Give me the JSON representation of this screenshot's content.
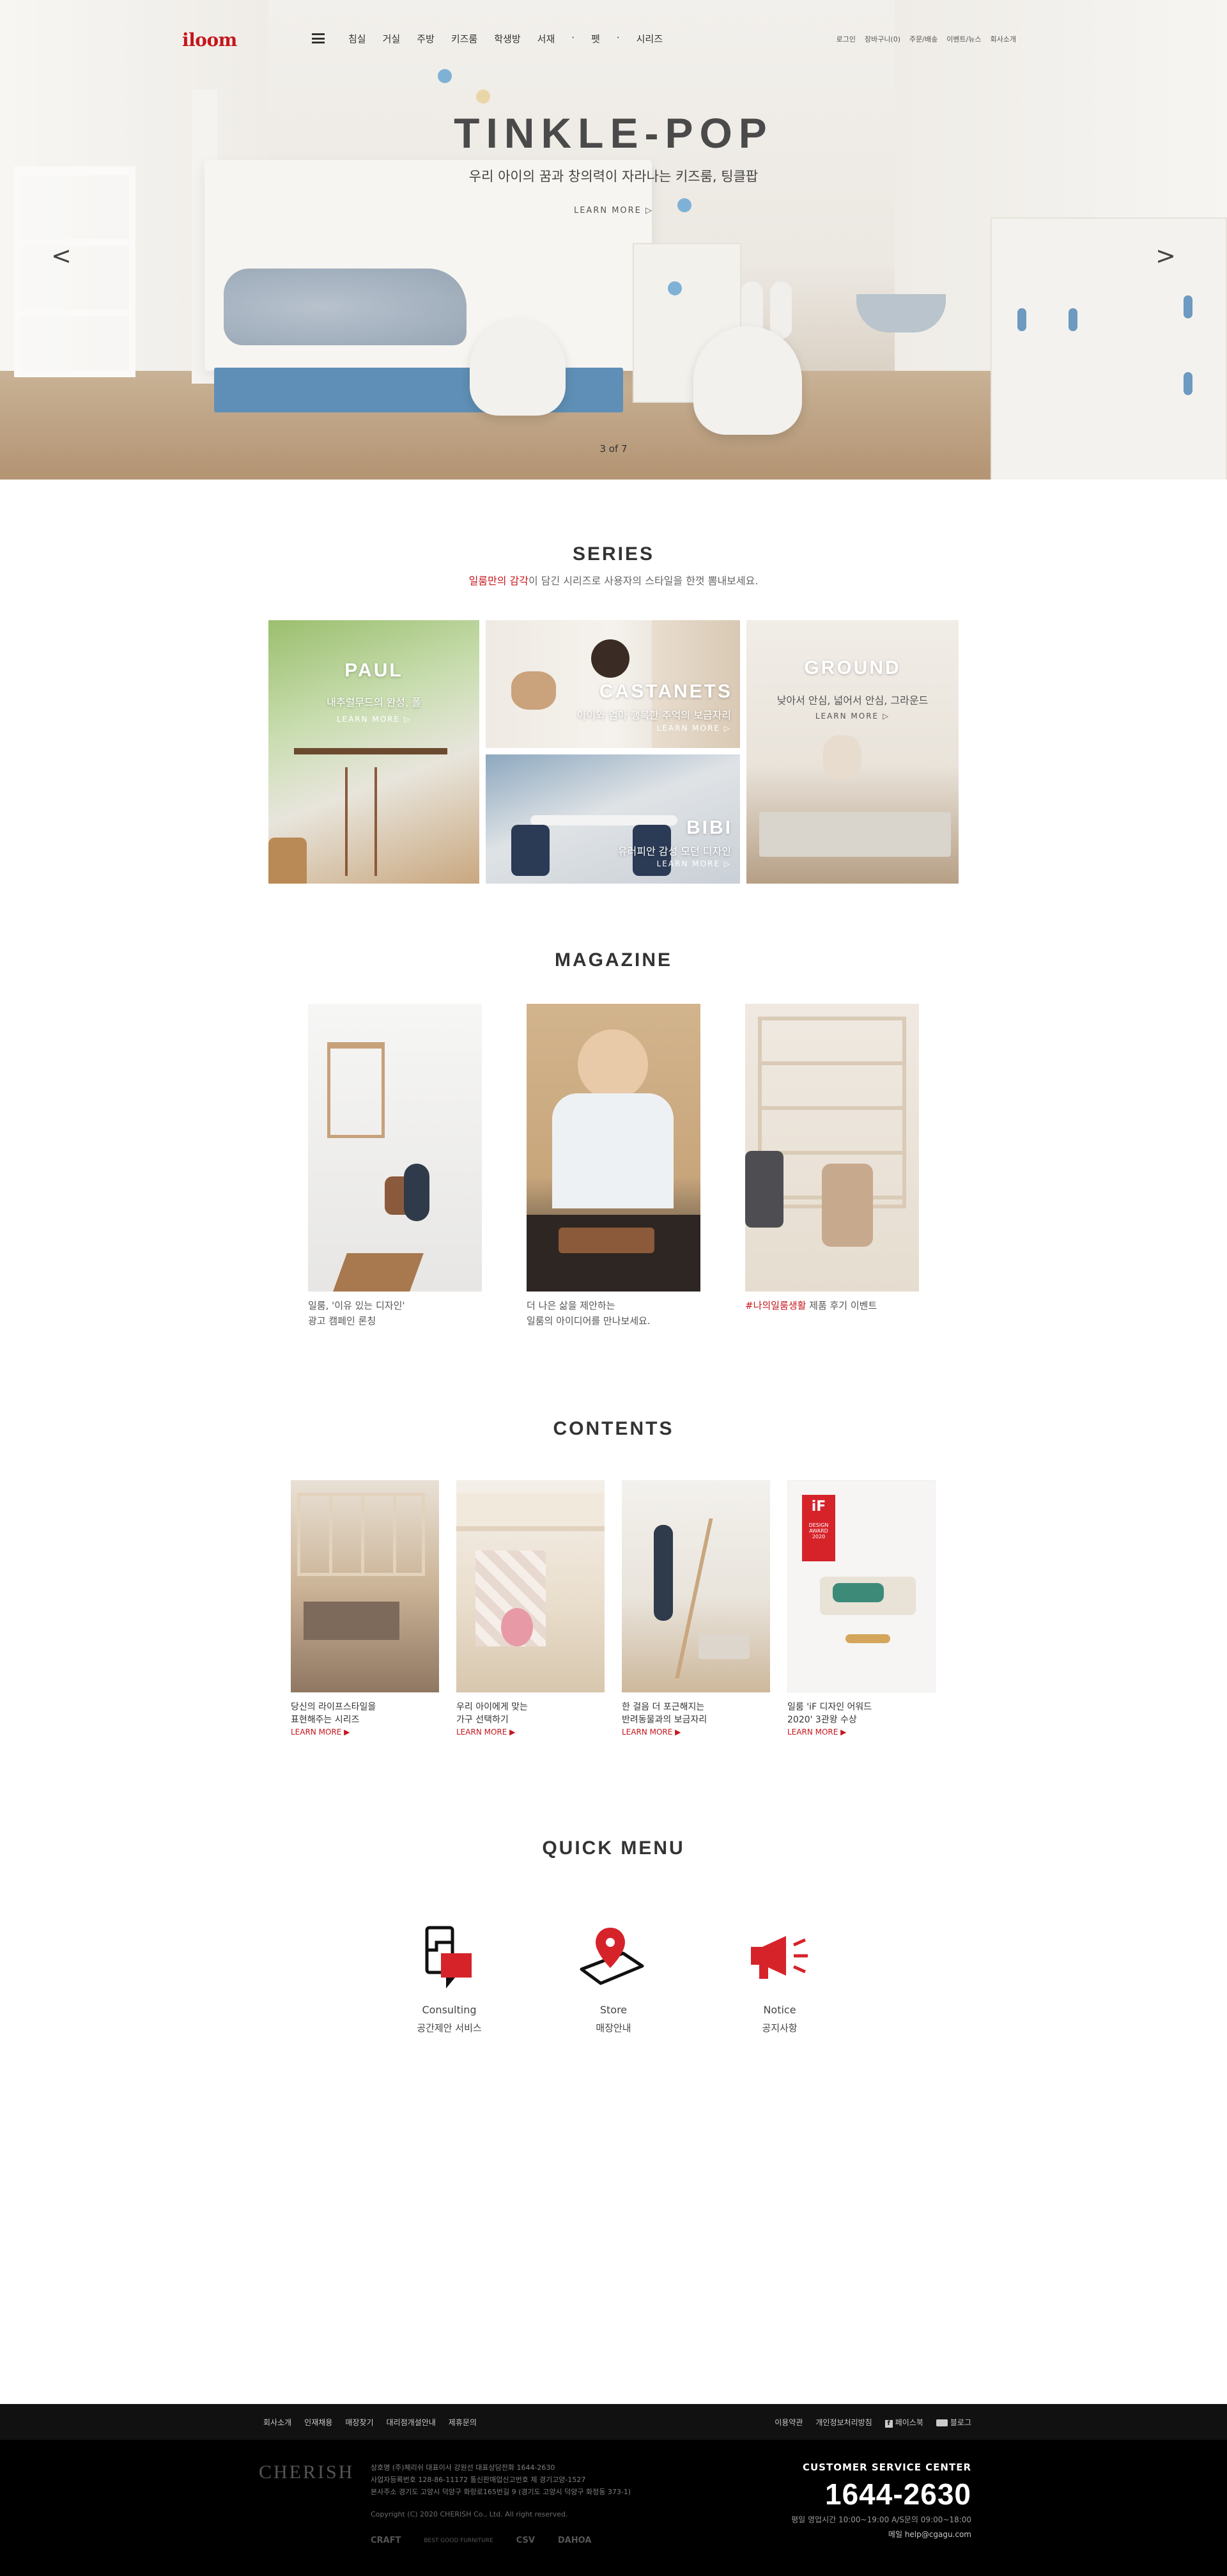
{
  "header": {
    "logo": "iloom",
    "nav": [
      "침실",
      "거실",
      "주방",
      "키즈룸",
      "학생방",
      "서재",
      "펫",
      "시리즈"
    ],
    "nav_separator": "·",
    "util": [
      "로그인",
      "장바구니(0)",
      "주문/배송",
      "이벤트/뉴스",
      "회사소개"
    ]
  },
  "hero": {
    "title": "TINKLE-POP",
    "subtitle": "우리 아이의 꿈과 창의력이 자라나는 키즈룸, 팅클팝",
    "more": "LEARN MORE ▷",
    "prev": "<",
    "next": ">",
    "pager": "3 of 7"
  },
  "series": {
    "title": "SERIES",
    "desc_highlight": "일룸만의 감각",
    "desc_rest": "이 담긴 시리즈로 사용자의 스타일을 한껏 뽐내보세요.",
    "items": [
      {
        "name": "PAUL",
        "desc": "내추럴무드의 완성, 폴",
        "more": "LEARN MORE ▷"
      },
      {
        "name": "CASTANETS",
        "desc": "아이와 엄마 행복한 추억의 보금자리",
        "more": "LEARN MORE ▷"
      },
      {
        "name": "GROUND",
        "desc": "낮아서 안심, 넓어서 안심, 그라운드",
        "more": "LEARN MORE ▷"
      },
      {
        "name": "BIBI",
        "desc": "유러피안 감성 모던 디자인",
        "more": "LEARN MORE ▷"
      }
    ]
  },
  "magazine": {
    "title": "MAGAZINE",
    "items": [
      {
        "line1": "일룸, '이유 있는 디자인'",
        "line2": "광고 캠페인 론칭"
      },
      {
        "line1": "더 나은 삶을 제안하는",
        "line2": "일룸의 아이디어를 만나보세요."
      },
      {
        "highlight": "#나의일룸생활",
        "rest": " 제품 후기 이벤트"
      }
    ]
  },
  "contents": {
    "title": "CONTENTS",
    "items": [
      {
        "line1": "당신의 라이프스타일을",
        "line2": "표현해주는 시리즈",
        "more": "LEARN MORE ▶"
      },
      {
        "line1": "우리 아이에게 맞는",
        "line2": "가구 선택하기",
        "more": "LEARN MORE ▶"
      },
      {
        "line1": "한 걸음 더 포근해지는",
        "line2": "반려동물과의 보금자리",
        "more": "LEARN MORE ▶"
      },
      {
        "line1": "일룸 'iF 디자인 어워드",
        "line2": "2020' 3관왕 수상",
        "more": "LEARN MORE ▶"
      }
    ],
    "badge": {
      "logo": "iF",
      "line1": "DESIGN",
      "line2": "AWARD",
      "line3": "2020"
    }
  },
  "quick_menu": {
    "title": "QUICK MENU",
    "items": [
      {
        "en": "Consulting",
        "ko": "공간제안 서비스",
        "icon": "consulting-icon"
      },
      {
        "en": "Store",
        "ko": "매장안내",
        "icon": "store-pin-icon"
      },
      {
        "en": "Notice",
        "ko": "공지사항",
        "icon": "megaphone-icon"
      }
    ]
  },
  "footer": {
    "links": [
      "회사소개",
      "인재채용",
      "매장찾기",
      "대리점개설안내",
      "제휴문의"
    ],
    "links_right": [
      "이용약관",
      "개인정보처리방침"
    ],
    "facebook": "페이스북",
    "blog": "블로그",
    "logo": "CHERISH",
    "info_lines": [
      "상호명 (주)체리쉬  대표이사 강원선  대표상담전화 1644-2630",
      "사업자등록번호 128-86-11172  통신판매업신고번호 제 경기고양-1527",
      "본사주소 경기도 고양시 덕양구 화랑로165번길 9 (경기도 고양시 덕양구 화정동 373-1)"
    ],
    "copyright": "Copyright (C) 2020 CHERISH Co., Ltd. All right reserved.",
    "certs": [
      "CRAFT",
      "BEST GOOD FURNITURE",
      "CSV",
      "DAHOA"
    ],
    "cs": {
      "title": "CUSTOMER SERVICE CENTER",
      "phone": "1644-2630",
      "hours": "평일 영업시간 10:00~19:00  A/S문의 09:00~18:00",
      "mail": "메일 help@cgagu.com"
    }
  },
  "colors": {
    "brand": "#c4161c",
    "footer_bg": "#000000"
  }
}
